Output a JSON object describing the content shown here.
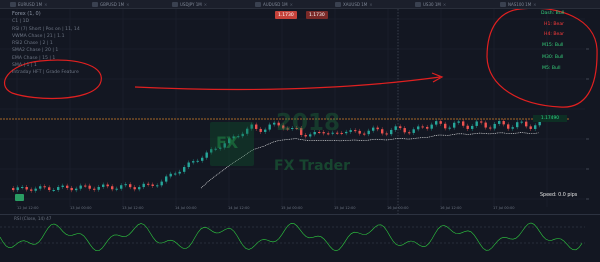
{
  "tabs": [
    {
      "label": "EURUSD 1M"
    },
    {
      "label": "GBPUSD 1M"
    },
    {
      "label": "USDJPY 1M"
    },
    {
      "label": "AUDUSD 1M"
    },
    {
      "label": "XAUUSD 1M"
    },
    {
      "label": "US30 1M"
    },
    {
      "label": "NAS100 1M"
    }
  ],
  "legend": {
    "title": "Forex (1, 0)",
    "lines": [
      "C1 | 1D",
      "RSI (7) Short | Pos on | 11, 14",
      "VWMA Chase | 21 | 1.1",
      "RSI2 Chase | 2 | 1",
      "SMA2 Chase | 20 | 1",
      "EMA Chase | 15 | 1",
      "SMA | 1 | 1",
      "Intraday HFT | Grade Feature"
    ]
  },
  "order_pills": [
    {
      "label": "1.1730"
    },
    {
      "label": "1.1730"
    }
  ],
  "signals": [
    {
      "label": "Dash: Bull",
      "color": "#36d17c"
    },
    {
      "label": "H1: Bear",
      "color": "#ff3b3b"
    },
    {
      "label": "H4: Bear",
      "color": "#ff3b3b"
    },
    {
      "label": "M15: Bull",
      "color": "#36d17c"
    },
    {
      "label": "M30: Bull",
      "color": "#36d17c"
    },
    {
      "label": "M5: Bull",
      "color": "#36d17c"
    }
  ],
  "price_tag": "1.17490",
  "speed": "Speed: 0.0 pips",
  "x_axis": [
    "12 Jul 12:00",
    "13 Jul 00:00",
    "13 Jul 12:00",
    "14 Jul 00:00",
    "14 Jul 12:00",
    "15 Jul 00:00",
    "15 Jul 12:00",
    "16 Jul 00:00",
    "16 Jul 12:00",
    "17 Jul 00:00"
  ],
  "rsi_label": "RSI (Close, 14) 47",
  "watermark": {
    "logo": "FX",
    "year": "2018",
    "name": "FX Trader"
  },
  "colors": {
    "bull": "#26a69a",
    "bear": "#ef5350",
    "annotation": "#e02020",
    "ma": "#ffffff",
    "rsi": "#2ecc40"
  }
}
